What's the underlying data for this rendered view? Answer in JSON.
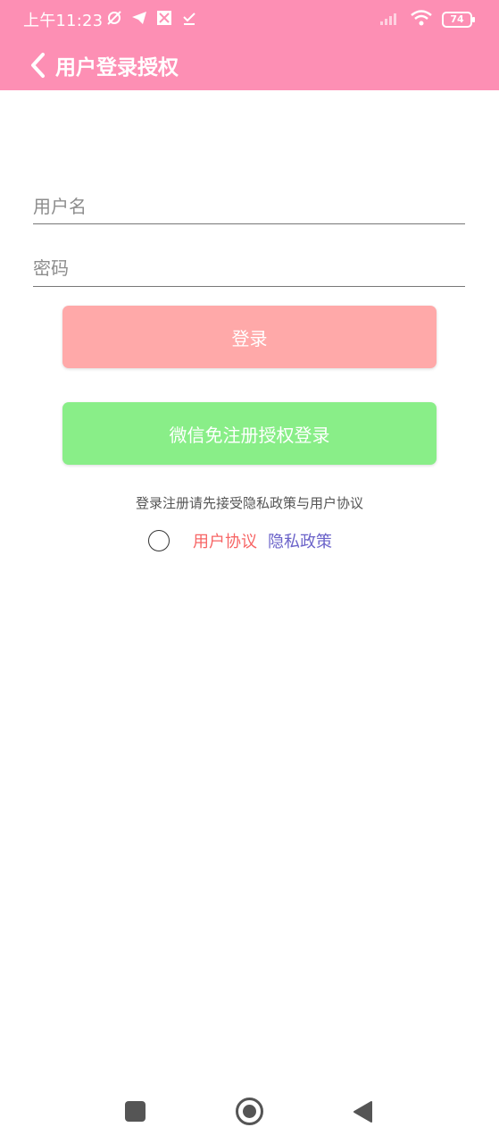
{
  "status_bar": {
    "time": "上午11:23",
    "battery": "74",
    "icons_left": [
      "muted-alarm-icon",
      "telegram-icon",
      "app-icon",
      "check-icon"
    ],
    "icons_right": [
      "signal-icon",
      "wifi-icon",
      "battery-icon"
    ]
  },
  "header": {
    "title": "用户登录授权",
    "color": "#fd8fb4"
  },
  "form": {
    "username_placeholder": "用户名",
    "password_placeholder": "密码",
    "username_value": "",
    "password_value": ""
  },
  "buttons": {
    "login_label": "登录",
    "login_color": "#ffa9a9",
    "wechat_label": "微信免注册授权登录",
    "wechat_color": "#89ee88"
  },
  "agreement": {
    "notice": "登录注册请先接受隐私政策与用户协议",
    "user_agreement_label": "用户协议",
    "privacy_policy_label": "隐私政策",
    "checked": false
  },
  "nav_bar": {
    "icons": [
      "recent-apps-icon",
      "home-icon",
      "back-triangle-icon"
    ]
  }
}
